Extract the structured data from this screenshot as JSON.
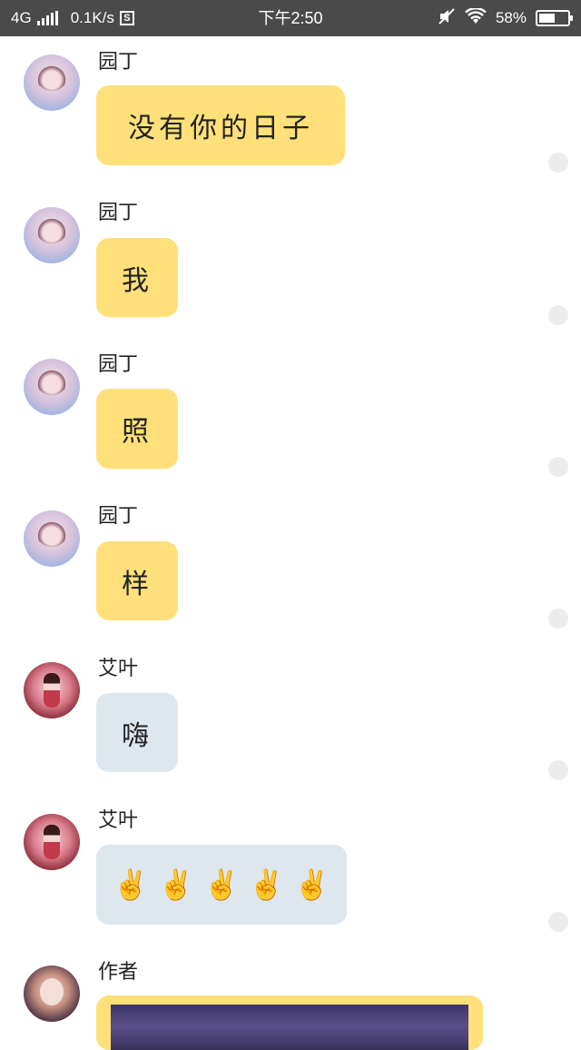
{
  "status_bar": {
    "network": "4G",
    "speed": "0.1K/s",
    "sd": "S",
    "time": "下午2:50",
    "battery_percent": "58%",
    "battery_level": 0.58
  },
  "messages": [
    {
      "sender": "园丁",
      "text": "没有你的日子",
      "bubble": "yellow",
      "avatar": "gardener"
    },
    {
      "sender": "园丁",
      "text": "我",
      "bubble": "yellow",
      "avatar": "gardener"
    },
    {
      "sender": "园丁",
      "text": "照",
      "bubble": "yellow",
      "avatar": "gardener"
    },
    {
      "sender": "园丁",
      "text": "样",
      "bubble": "yellow",
      "avatar": "gardener"
    },
    {
      "sender": "艾叶",
      "text": "嗨",
      "bubble": "gray",
      "avatar": "aiye"
    },
    {
      "sender": "艾叶",
      "emoji": [
        "✌️",
        "✌️",
        "✌️",
        "✌️",
        "✌️"
      ],
      "emoji_name": "victory-hand-emoji",
      "bubble": "gray",
      "avatar": "aiye"
    },
    {
      "sender": "作者",
      "image": "photo",
      "bubble": "yellow",
      "avatar": "author"
    }
  ],
  "colors": {
    "yellow_bubble": "#ffe07a",
    "gray_bubble": "#dee6ee",
    "status_bar": "#4a4a4a"
  }
}
